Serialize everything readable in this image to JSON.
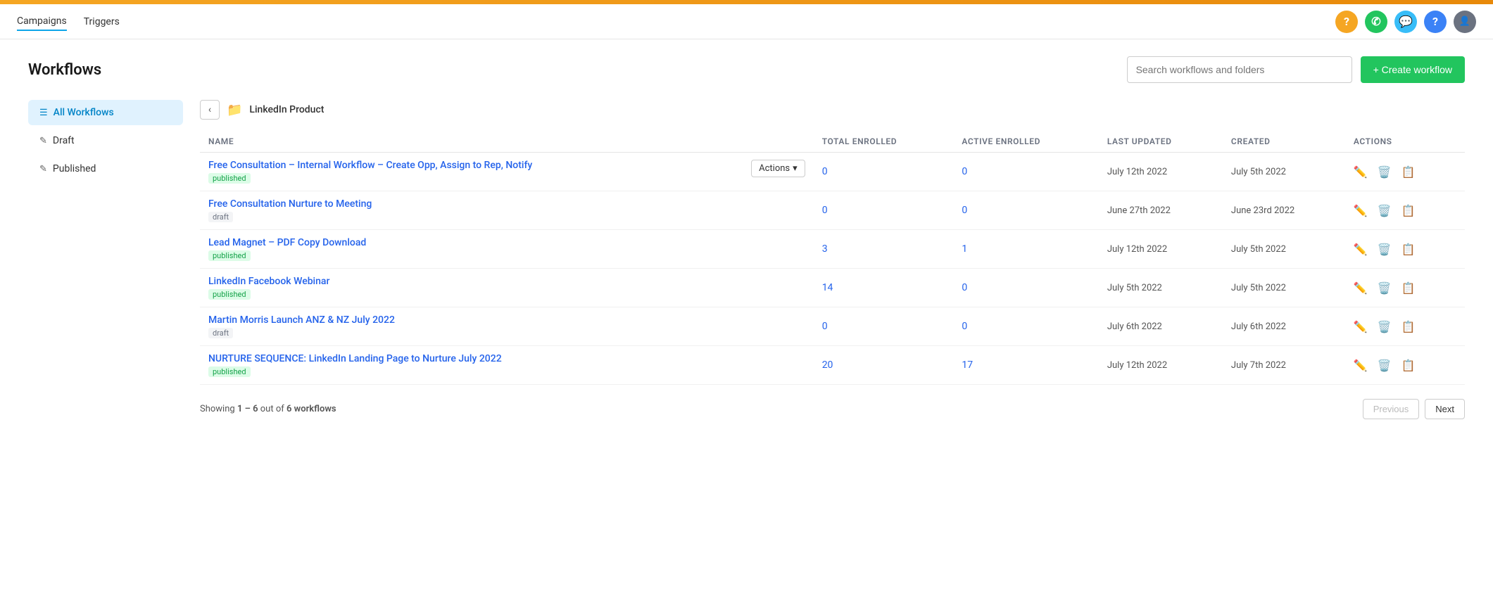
{
  "topbar": {},
  "navbar": {
    "links": [
      {
        "label": "Campaigns",
        "active": false
      },
      {
        "label": "Triggers",
        "active": false
      }
    ],
    "icons": [
      {
        "name": "help-icon",
        "symbol": "?",
        "color": "yellow"
      },
      {
        "name": "phone-icon",
        "symbol": "✆",
        "color": "green"
      },
      {
        "name": "chat-icon",
        "symbol": "💬",
        "color": "blue-light"
      },
      {
        "name": "info-icon",
        "symbol": "?",
        "color": "blue"
      },
      {
        "name": "user-icon",
        "symbol": "👤",
        "color": "gray"
      }
    ]
  },
  "page": {
    "title": "Workflows",
    "search_placeholder": "Search workflows and folders",
    "create_button": "+ Create workflow"
  },
  "sidebar": {
    "items": [
      {
        "label": "All Workflows",
        "active": true,
        "icon": "☰"
      },
      {
        "label": "Draft",
        "active": false,
        "icon": "✎"
      },
      {
        "label": "Published",
        "active": false,
        "icon": "✎"
      }
    ]
  },
  "folder_nav": {
    "folder_name": "LinkedIn Product",
    "back_label": "‹"
  },
  "table": {
    "columns": [
      "NAME",
      "TOTAL ENROLLED",
      "ACTIVE ENROLLED",
      "LAST UPDATED",
      "CREATED",
      "ACTIONS"
    ],
    "rows": [
      {
        "name": "Free Consultation – Internal Workflow – Create Opp, Assign to Rep, Notify",
        "status": "published",
        "status_class": "published",
        "total_enrolled": "0",
        "active_enrolled": "0",
        "last_updated": "July 12th 2022",
        "created": "July 5th 2022",
        "show_actions_dropdown": true
      },
      {
        "name": "Free Consultation Nurture to Meeting",
        "status": "draft",
        "status_class": "draft",
        "total_enrolled": "0",
        "active_enrolled": "0",
        "last_updated": "June 27th 2022",
        "created": "June 23rd 2022",
        "show_actions_dropdown": false
      },
      {
        "name": "Lead Magnet – PDF Copy Download",
        "status": "published",
        "status_class": "published",
        "total_enrolled": "3",
        "active_enrolled": "1",
        "last_updated": "July 12th 2022",
        "created": "July 5th 2022",
        "show_actions_dropdown": false
      },
      {
        "name": "LinkedIn Facebook Webinar",
        "status": "published",
        "status_class": "published",
        "total_enrolled": "14",
        "active_enrolled": "0",
        "last_updated": "July 5th 2022",
        "created": "July 5th 2022",
        "show_actions_dropdown": false
      },
      {
        "name": "Martin Morris Launch ANZ & NZ July 2022",
        "status": "draft",
        "status_class": "draft",
        "total_enrolled": "0",
        "active_enrolled": "0",
        "last_updated": "July 6th 2022",
        "created": "July 6th 2022",
        "show_actions_dropdown": false
      },
      {
        "name": "NURTURE SEQUENCE: LinkedIn Landing Page to Nurture July 2022",
        "status": "published",
        "status_class": "published",
        "total_enrolled": "20",
        "active_enrolled": "17",
        "last_updated": "July 12th 2022",
        "created": "July 7th 2022",
        "show_actions_dropdown": false
      }
    ]
  },
  "pagination": {
    "showing_text": "Showing",
    "range": "1 – 6",
    "of_text": "out of",
    "total": "6 workflows",
    "previous_label": "Previous",
    "next_label": "Next"
  },
  "actions_dropdown": {
    "label": "Actions",
    "chevron": "▾"
  }
}
